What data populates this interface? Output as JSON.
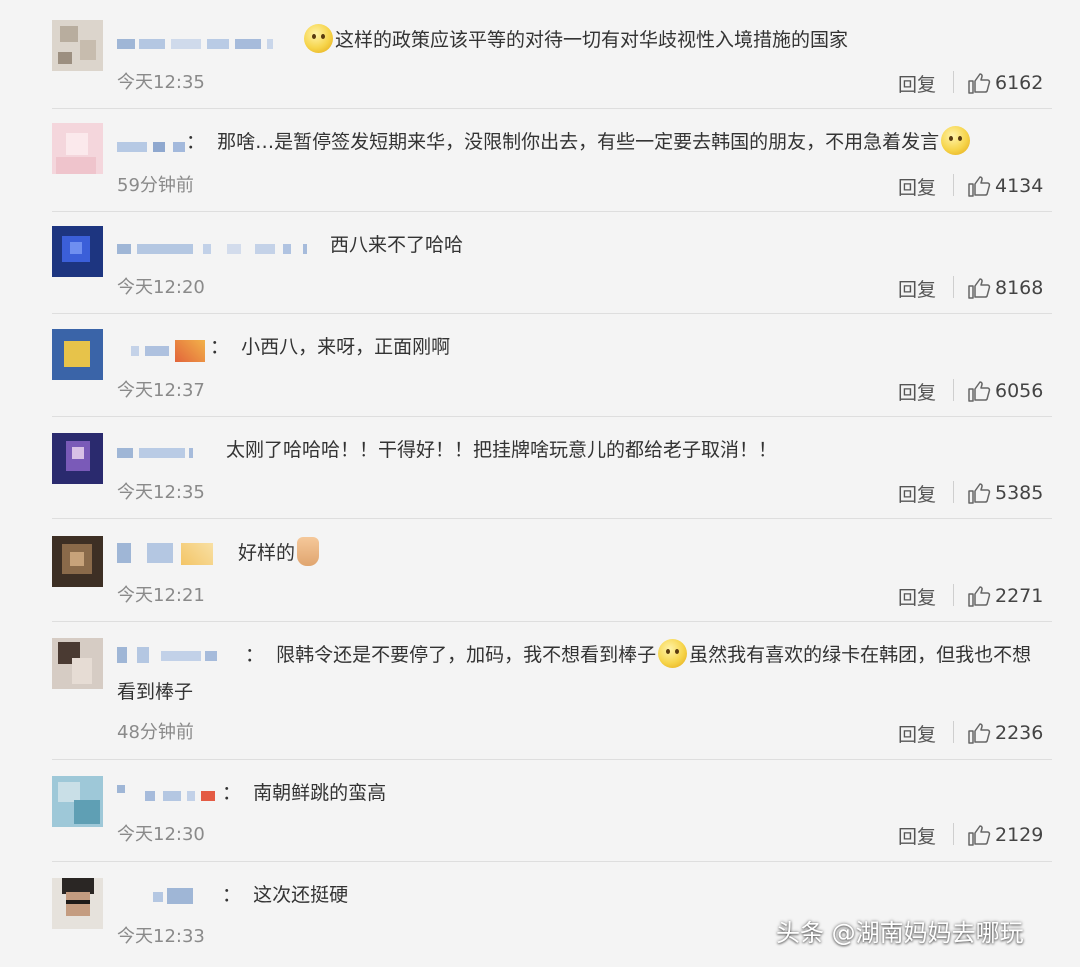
{
  "labels": {
    "reply": "回复"
  },
  "comments": [
    {
      "text": "这样的政策应该平等的对待一切有对华歧视性入境措施的国家",
      "emoji_before": "scared-face",
      "emoji_after": null,
      "time": "今天12:35",
      "likes": "6162"
    },
    {
      "text": "那啥…是暂停签发短期来华，没限制你出去，有些一定要去韩国的朋友，不用急着发言",
      "emoji_before": null,
      "emoji_after": "laughing-tears",
      "time": "59分钟前",
      "likes": "4134",
      "separator": "："
    },
    {
      "text": "西八来不了哈哈",
      "time": "今天12:20",
      "likes": "8168"
    },
    {
      "text": "小西八，来呀，正面刚啊",
      "time": "今天12:37",
      "likes": "6056",
      "separator": "："
    },
    {
      "text": "太刚了哈哈哈！！干得好！！把挂牌啥玩意儿的都给老子取消！！",
      "time": "今天12:35",
      "likes": "5385"
    },
    {
      "text": "好样的",
      "emoji_after": "thumbs-up",
      "time": "今天12:21",
      "likes": "2271"
    },
    {
      "text_part1": "限韩令还是不要停了，加码，我不想看到棒子",
      "emoji_mid": "smile",
      "text_part2": "虽然我有喜欢的绿卡在韩团，但我也不想看到棒子",
      "time": "48分钟前",
      "likes": "2236",
      "separator": "："
    },
    {
      "text": "南朝鲜跳的蛮高",
      "time": "今天12:30",
      "likes": "2129",
      "separator": "："
    },
    {
      "text": "这次还挺硬",
      "time": "今天12:33",
      "separator": "："
    }
  ],
  "watermark": "头条 @湖南妈妈去哪玩",
  "colors": {
    "background": "#f4f4f4",
    "text": "#333333",
    "meta": "#8a8a8a"
  }
}
